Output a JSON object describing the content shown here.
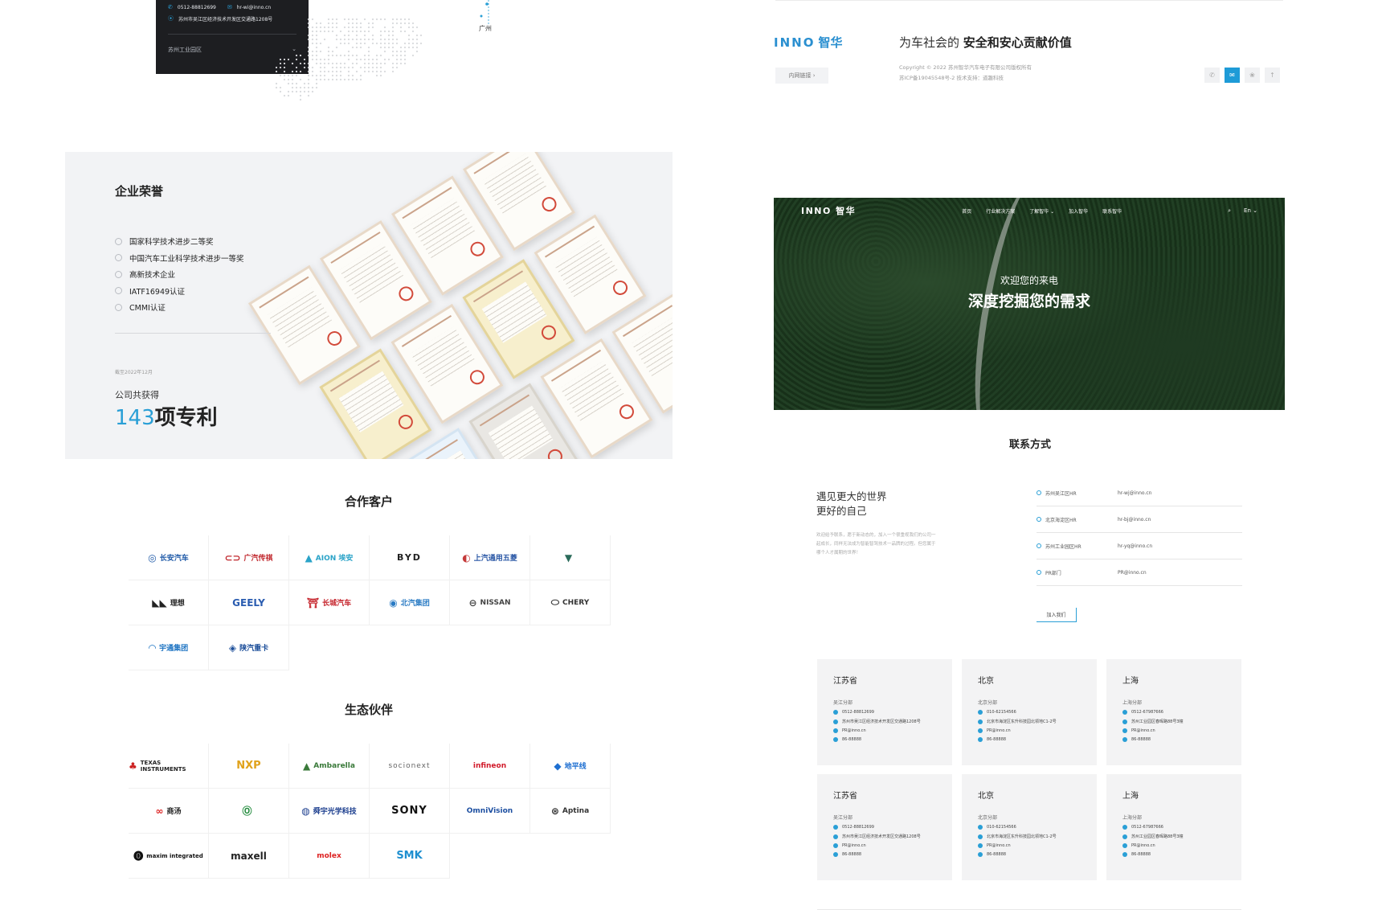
{
  "address_card": {
    "phone": "0512-88812699",
    "email": "hr-wi@inno.cn",
    "address": "苏州市吴江区经济技术开发区交通路1208号",
    "park": "苏州工业园区",
    "expand_icon": "chevron-down-icon"
  },
  "map": {
    "city_label": "广州"
  },
  "honor": {
    "title": "企业荣誉",
    "items": [
      "国家科学技术进步二等奖",
      "中国汽车工业科学技术进步一等奖",
      "高新技术企业",
      "IATF16949认证",
      "CMMI认证"
    ],
    "date_note": "截至2022年12月",
    "summary_prefix": "公司共获得",
    "patent_count": "143",
    "patent_suffix": "项专利"
  },
  "customers": {
    "title": "合作客户",
    "logos": [
      "长安汽车",
      "广汽传祺",
      "AION 埃安",
      "BYD",
      "上汽通用五菱",
      "",
      "理想",
      "GEELY",
      "长城汽车",
      "北汽集团",
      "NISSAN",
      "CHERY",
      "宇通集团",
      "陕汽重卡"
    ]
  },
  "partners": {
    "title": "生态伙伴",
    "logos": [
      "TEXAS INSTRUMENTS",
      "NXP",
      "Ambarella",
      "socionext",
      "infineon",
      "地平线",
      "商汤",
      "",
      "舜宇光学科技",
      "SONY",
      "OmniVision",
      "Aptina",
      "maxim integrated",
      "maxell",
      "molex",
      "SMK"
    ]
  },
  "footer": {
    "logo_en": "INNO",
    "logo_zh": "智华",
    "slogan_prefix": "为车社会的",
    "slogan_bold": "安全和安心贡献价值",
    "internal_link": "内网链接 ›",
    "copyright": "Copyright © 2022 苏州智华汽车电子有限公司版权所有",
    "icp": "苏ICP备19045548号-2 技术支持：道趣科技",
    "social_icons": [
      "phone-icon",
      "wechat-icon",
      "weibo-icon",
      "share-icon"
    ],
    "social_glyphs": [
      "✆",
      "✉",
      "❀",
      "↑"
    ]
  },
  "hero": {
    "logo": "INNO 智华",
    "menu": [
      "首页",
      "行业解决方案",
      "了解智华 ⌄",
      "加入智华",
      "联系智华"
    ],
    "search_icon": "⌕",
    "lang": "En ⌄",
    "welcome": "欢迎您的来电",
    "headline": "深度挖掘您的需求"
  },
  "contact": {
    "title": "联系方式",
    "meet_line1": "遇见更大的世界",
    "meet_line2": "更好的自己",
    "desc": "欢迎给予联系，愿于新动态的，加入一个很重视我们的公司一起成长，同样无法成为智能智驾技术一品牌的过程。但您属于哪个人才属期的世界！",
    "hr": [
      {
        "name": "苏州吴江区HR",
        "email": "hr-wj@inno.cn"
      },
      {
        "name": "北京海淀区HR",
        "email": "hr-bj@inno.cn"
      },
      {
        "name": "苏州工业园区HR",
        "email": "hr-yq@inno.cn"
      },
      {
        "name": "PR部门",
        "email": "PR@inno.cn"
      }
    ],
    "join_label": "加入我们"
  },
  "offices": [
    {
      "city": "江苏省",
      "branch": "吴江分部",
      "phone": "0512-88812699",
      "address": "苏州市吴江区经济技术开发区交通路1208号",
      "email": "PR@inno.cn",
      "fax": "86-88888"
    },
    {
      "city": "北京",
      "branch": "北京分部",
      "phone": "010-62154566",
      "address": "北京市海淀区东升科技园北领地C1-2号",
      "email": "PR@inno.cn",
      "fax": "86-88888"
    },
    {
      "city": "上海",
      "branch": "上海分部",
      "phone": "0512-67987666",
      "address": "苏州工业园区春晖路88号3幢",
      "email": "PR@inno.cn",
      "fax": "86-88888"
    },
    {
      "city": "江苏省",
      "branch": "吴江分部",
      "phone": "0512-88812699",
      "address": "苏州市吴江区经济技术开发区交通路1208号",
      "email": "PR@inno.cn",
      "fax": "86-88888"
    },
    {
      "city": "北京",
      "branch": "北京分部",
      "phone": "010-62154566",
      "address": "北京市海淀区东升科技园北领地C1-2号",
      "email": "PR@inno.cn",
      "fax": "86-88888"
    },
    {
      "city": "上海",
      "branch": "上海分部",
      "phone": "0512-67987666",
      "address": "苏州工业园区春晖路88号3幢",
      "email": "PR@inno.cn",
      "fax": "86-88888"
    }
  ],
  "colors": {
    "accent": "#2a9fd6",
    "dark_card": "#1d1e21",
    "honor_bg": "#f2f3f5"
  }
}
